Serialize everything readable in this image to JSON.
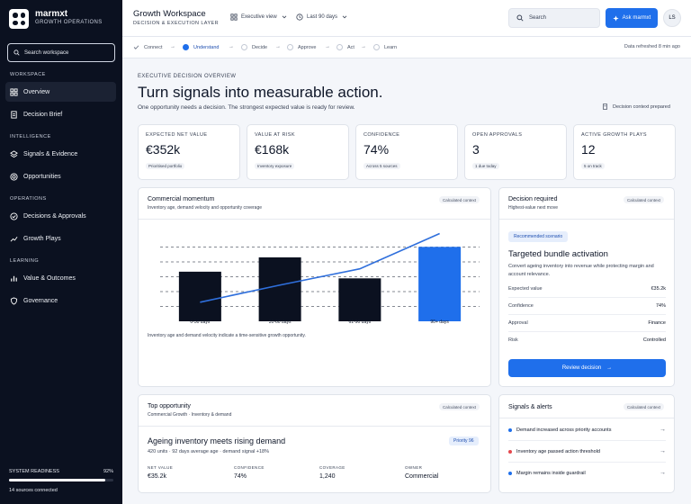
{
  "brand": {
    "name": "marmxt",
    "subtitle": "GROWTH OPERATIONS"
  },
  "sidebar": {
    "search_placeholder": "Search workspace",
    "sections": [
      {
        "label": "WORKSPACE",
        "items": [
          {
            "label": "Overview",
            "icon": "grid-icon",
            "active": true
          },
          {
            "label": "Decision Brief",
            "icon": "document-icon"
          }
        ]
      },
      {
        "label": "INTELLIGENCE",
        "items": [
          {
            "label": "Signals & Evidence",
            "icon": "layers-icon"
          },
          {
            "label": "Opportunities",
            "icon": "target-icon"
          }
        ]
      },
      {
        "label": "OPERATIONS",
        "items": [
          {
            "label": "Decisions & Approvals",
            "icon": "check-circle-icon"
          },
          {
            "label": "Growth Plays",
            "icon": "trend-icon"
          }
        ]
      },
      {
        "label": "LEARNING",
        "items": [
          {
            "label": "Value & Outcomes",
            "icon": "chart-icon"
          },
          {
            "label": "Governance",
            "icon": "shield-icon"
          }
        ]
      }
    ],
    "readiness": {
      "label": "SYSTEM READINESS",
      "value_text": "92%",
      "fraction": 0.92
    },
    "sources": "14 sources connected"
  },
  "header": {
    "title": "Growth Workspace",
    "subtitle": "DECISION & EXECUTION LAYER",
    "view": "Executive view",
    "range": "Last 90 days",
    "search_placeholder": "Search",
    "ask_label": "Ask marmxt",
    "avatar": "LS"
  },
  "stepper": {
    "steps": [
      "Connect",
      "Understand",
      "Decide",
      "Approve",
      "Act",
      "Learn"
    ],
    "current": "Understand",
    "refreshed": "Data refreshed 8 min ago"
  },
  "overview": {
    "kicker": "EXECUTIVE DECISION OVERVIEW",
    "headline": "Turn signals into measurable action.",
    "subline": "One opportunity needs a decision. The strongest expected value is ready for review.",
    "context_label": "Decision context prepared"
  },
  "kpis": [
    {
      "label": "EXPECTED NET VALUE",
      "value": "€352k",
      "badge": "Prioritised portfolio"
    },
    {
      "label": "VALUE AT RISK",
      "value": "€168k",
      "badge": "Inventory exposure"
    },
    {
      "label": "CONFIDENCE",
      "value": "74%",
      "badge": "Across 5 sources"
    },
    {
      "label": "OPEN APPROVALS",
      "value": "3",
      "badge": "1 due today"
    },
    {
      "label": "ACTIVE GROWTH PLAYS",
      "value": "12",
      "badge": "5 on track"
    }
  ],
  "commercial": {
    "title": "Commercial momentum",
    "subtitle": "Inventory age, demand velocity and opportunity coverage",
    "pill": "Calculated context",
    "caption": "Inventory age and demand velocity indicate a time-sensitive growth opportunity."
  },
  "chart_data": {
    "type": "bar",
    "categories": [
      "0-30 days",
      "31-60 days",
      "61-90 days",
      "90+ days"
    ],
    "values": [
      52,
      67,
      45,
      78
    ],
    "highlight_index": 3,
    "line_values": [
      20,
      38,
      55,
      92
    ],
    "ylim": [
      0,
      100
    ],
    "grid": true,
    "colors": {
      "bar": "#0b1120",
      "highlight": "#1f6feb",
      "line": "#2f6fdc"
    }
  },
  "decision": {
    "title": "Decision required",
    "subtitle": "Highest-value next move",
    "pill": "Calculated context",
    "tag": "Recommended scenario",
    "rec_title": "Targeted bundle activation",
    "rec_desc": "Convert ageing inventory into revenue while protecting margin and account relevance.",
    "rows": [
      {
        "label": "Expected value",
        "value": "€35.2k"
      },
      {
        "label": "Confidence",
        "value": "74%"
      },
      {
        "label": "Approval",
        "value": "Finance"
      },
      {
        "label": "Risk",
        "value": "Controlled"
      }
    ],
    "button": "Review decision"
  },
  "top_opportunity": {
    "title": "Top opportunity",
    "subtitle": "Commercial Growth · Inventory & demand",
    "pill": "Calculated context",
    "headline": "Ageing inventory meets rising demand",
    "details": "420 units · 92 days average age · demand signal +18%",
    "priority": "Priority 96",
    "metrics": [
      {
        "label": "NET VALUE",
        "value": "€35.2k"
      },
      {
        "label": "CONFIDENCE",
        "value": "74%"
      },
      {
        "label": "COVERAGE",
        "value": "1,240"
      },
      {
        "label": "OWNER",
        "value": "Commercial"
      }
    ]
  },
  "alerts": {
    "title": "Signals & alerts",
    "pill": "Calculated context",
    "items": [
      {
        "label": "Demand increased across priority accounts",
        "color": "#1f6feb"
      },
      {
        "label": "Inventory age passed action threshold",
        "color": "#e5484d"
      },
      {
        "label": "Margin remains inside guardrail",
        "color": "#1f6feb"
      }
    ]
  }
}
